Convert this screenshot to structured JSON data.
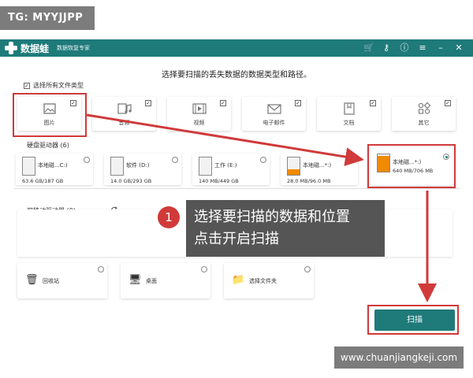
{
  "watermarks": {
    "top": "TG: MYYJJPP",
    "bottom": "www.chuanjiangkeji.com"
  },
  "titlebar": {
    "app_name": "数据蛙",
    "app_subtitle": "数据恢复专家",
    "bg_color": "#1f7a7a",
    "icons": [
      "cart-icon",
      "key-icon",
      "info-icon",
      "menu-icon",
      "minimize-icon",
      "close-icon"
    ],
    "icon_glyphs": [
      "🛒",
      "⚷",
      "ⓘ",
      "≡",
      "–",
      "✕"
    ]
  },
  "heading": "选择要扫描的丢失数据的数据类型和路径。",
  "select_all": {
    "label": "选择所有文件类型",
    "checked": true
  },
  "file_types": [
    {
      "label": "图片",
      "checked": true,
      "icon": "image-icon"
    },
    {
      "label": "音频",
      "checked": true,
      "icon": "audio-icon"
    },
    {
      "label": "视频",
      "checked": true,
      "icon": "video-icon"
    },
    {
      "label": "电子邮件",
      "checked": true,
      "icon": "email-icon"
    },
    {
      "label": "文档",
      "checked": true,
      "icon": "document-icon"
    },
    {
      "label": "其它",
      "checked": true,
      "icon": "other-icon"
    }
  ],
  "hard_drives": {
    "title": "硬盘驱动器 (6)",
    "items": [
      {
        "name": "本地磁...C:)",
        "size": "63.6 GB/187 GB",
        "fill_fraction": 0.0,
        "selected": false
      },
      {
        "name": "软件 (D:)",
        "size": "14.0 GB/293 GB",
        "fill_fraction": 0.0,
        "selected": false
      },
      {
        "name": "工作 (E:)",
        "size": "140 MB/449 GB",
        "fill_fraction": 0.0,
        "selected": false
      },
      {
        "name": "本地磁...*:)",
        "size": "28.0 MB/96.0 MB",
        "fill_fraction": 0.3,
        "selected": false
      },
      {
        "name": "本地磁...*:)",
        "size": "640 MB/706 MB",
        "fill_fraction": 0.9,
        "selected": true
      }
    ]
  },
  "removable": {
    "title": "可移动驱动器 (0)"
  },
  "locations": [
    {
      "label": "回收站",
      "icon": "recycle-bin-icon",
      "glyph": "🗑"
    },
    {
      "label": "桌面",
      "icon": "desktop-icon",
      "glyph": "🖥"
    },
    {
      "label": "选择文件夹",
      "icon": "folder-icon",
      "glyph": "📁"
    }
  ],
  "scan_button": "扫描",
  "callout": {
    "number": "1",
    "text_line1": "选择要扫描的数据和位置",
    "text_line2": "点击开启扫描"
  },
  "annotation_color": "#d03a3a"
}
